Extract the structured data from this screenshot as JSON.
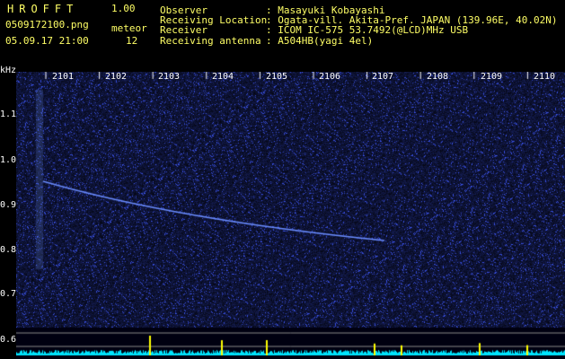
{
  "header": {
    "app_title": "HROFFT",
    "version": "1.00",
    "file_name": "0509172100.png",
    "meteor_label": "meteor",
    "datetime": "05.09.17 21:00",
    "meteor_count": "12"
  },
  "info": [
    {
      "label": "Observer",
      "value": ": Masayuki Kobayashi"
    },
    {
      "label": "Receiving Location",
      "value": ": Ogata-vill. Akita-Pref. JAPAN (139.96E, 40.02N)"
    },
    {
      "label": "Receiver",
      "value": ": ICOM IC-575 53.7492(@LCD)MHz USB"
    },
    {
      "label": "Receiving antenna",
      "value": ": A504HB(yagi 4el)"
    }
  ],
  "axis": {
    "y_unit": "kHz",
    "y_ticks": [
      "1.1",
      "1.0",
      "0.9",
      "0.8",
      "0.7",
      "0.6"
    ],
    "x_ticks": [
      "2101",
      "2102",
      "2103",
      "2104",
      "2105",
      "2106",
      "2107",
      "2108",
      "2109",
      "2110"
    ]
  },
  "colors": {
    "label": "#ffff66",
    "spectrum": "#1b2a7a",
    "trail": "#6a8cff",
    "baseline": "#00e5ff"
  }
}
